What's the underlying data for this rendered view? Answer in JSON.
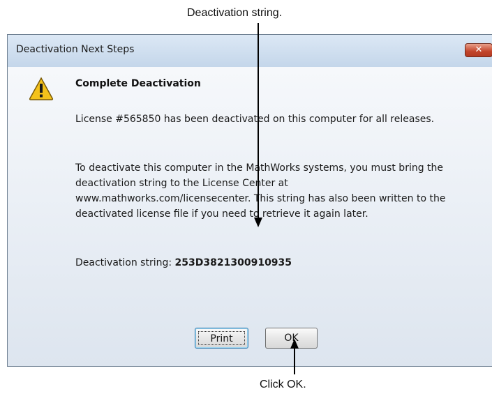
{
  "callouts": {
    "top": "Deactivation string.",
    "bottom": "Click OK."
  },
  "dialog": {
    "title": "Deactivation Next Steps",
    "close_glyph": "✕",
    "icon": "warning-icon",
    "heading": "Complete Deactivation",
    "paragraph1": "License #565850 has been deactivated on this computer for all releases.",
    "paragraph2": "To deactivate this computer in the MathWorks systems, you must bring the deactivation string to the License Center at www.mathworks.com/licensecenter. This string has also been written to the deactivated license file if you need to retrieve it again later.",
    "deactivation_label": "Deactivation string:",
    "deactivation_value": "253D3821300910935",
    "buttons": {
      "print": "Print",
      "ok": "OK"
    }
  },
  "colors": {
    "title_bar": "#c4d6ea",
    "close_button": "#c2442a",
    "warning_yellow": "#f4c21b"
  }
}
